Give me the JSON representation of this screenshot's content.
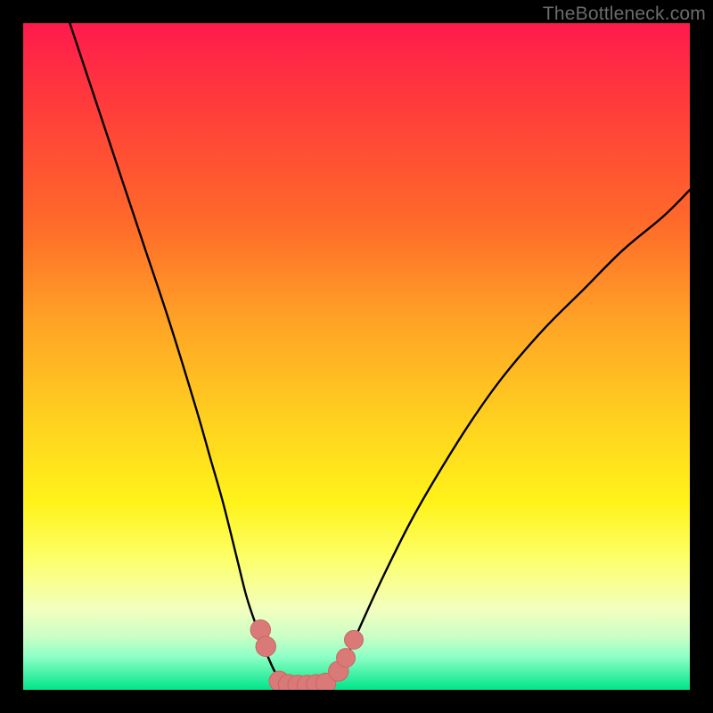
{
  "watermark": {
    "text": "TheBottleneck.com"
  },
  "colors": {
    "curve": "#000000",
    "marker_fill": "#d97a78",
    "marker_stroke": "#c96765",
    "gradient_top": "#ff1a4d",
    "gradient_bottom": "#00e58a"
  },
  "chart_data": {
    "type": "line",
    "title": "",
    "xlabel": "",
    "ylabel": "",
    "xlim": [
      0,
      100
    ],
    "ylim": [
      0,
      100
    ],
    "grid": false,
    "legend": false,
    "series": [
      {
        "name": "left-curve",
        "x": [
          7,
          10,
          14,
          18,
          22,
          26,
          28,
          30,
          32,
          33.5,
          35,
          36.3,
          37.5,
          38.6,
          39
        ],
        "values": [
          100,
          91,
          79,
          67,
          55,
          42,
          35,
          28,
          20,
          14,
          9.5,
          6.0,
          3.2,
          1.2,
          0.8
        ]
      },
      {
        "name": "floor",
        "x": [
          39,
          40,
          41,
          42,
          43,
          44,
          45,
          46
        ],
        "values": [
          0.8,
          0.6,
          0.6,
          0.6,
          0.6,
          0.7,
          0.9,
          1.2
        ]
      },
      {
        "name": "right-curve",
        "x": [
          46,
          47.5,
          49,
          51,
          54,
          58,
          62,
          67,
          72,
          78,
          84,
          90,
          96,
          100
        ],
        "values": [
          1.2,
          3.0,
          6.0,
          10.5,
          17,
          25,
          32,
          40,
          47,
          54,
          60,
          66,
          71,
          75
        ]
      }
    ],
    "markers": [
      {
        "x": 35.6,
        "y": 9.0,
        "r": 1.5
      },
      {
        "x": 36.4,
        "y": 6.5,
        "r": 1.5
      },
      {
        "x": 38.4,
        "y": 1.3,
        "r": 1.5
      },
      {
        "x": 39.8,
        "y": 0.8,
        "r": 1.5
      },
      {
        "x": 41.2,
        "y": 0.7,
        "r": 1.5
      },
      {
        "x": 42.6,
        "y": 0.7,
        "r": 1.5
      },
      {
        "x": 44.0,
        "y": 0.8,
        "r": 1.5
      },
      {
        "x": 45.4,
        "y": 1.0,
        "r": 1.5
      },
      {
        "x": 47.3,
        "y": 2.8,
        "r": 1.5
      },
      {
        "x": 48.4,
        "y": 4.8,
        "r": 1.4
      },
      {
        "x": 49.6,
        "y": 7.5,
        "r": 1.4
      }
    ]
  }
}
